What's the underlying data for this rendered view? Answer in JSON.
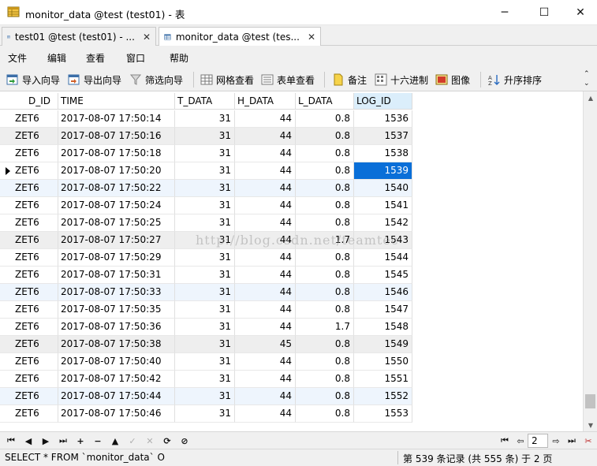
{
  "window": {
    "title": "monitor_data @test (test01) - 表",
    "controls": {
      "minimize": "─",
      "maximize": "☐",
      "close": "✕"
    }
  },
  "tabs": [
    {
      "label": "test01 @test (test01) - ...",
      "close": "✕",
      "active": false
    },
    {
      "label": "monitor_data @test (tes...",
      "close": "✕",
      "active": true
    }
  ],
  "menu": [
    "文件",
    "编辑",
    "查看",
    "窗口",
    "帮助"
  ],
  "toolbar": {
    "import_wizard": "导入向导",
    "export_wizard": "导出向导",
    "filter_wizard": "筛选向导",
    "grid_view": "网格查看",
    "form_view": "表单查看",
    "memo": "备注",
    "hex": "十六进制",
    "image": "图像",
    "sort_asc": "升序排序",
    "overflow": "⌃⌄"
  },
  "grid": {
    "columns": [
      "D_ID",
      "TIME",
      "T_DATA",
      "H_DATA",
      "L_DATA",
      "LOG_ID"
    ],
    "sorted_column_index": 0,
    "selected_column_index": 5,
    "rows": [
      [
        "ZET6",
        "2017-08-07 17:50:14",
        "31",
        "44",
        "0.8",
        "1536"
      ],
      [
        "ZET6",
        "2017-08-07 17:50:16",
        "31",
        "44",
        "0.8",
        "1537"
      ],
      [
        "ZET6",
        "2017-08-07 17:50:18",
        "31",
        "44",
        "0.8",
        "1538"
      ],
      [
        "ZET6",
        "2017-08-07 17:50:20",
        "31",
        "44",
        "0.8",
        "1539"
      ],
      [
        "ZET6",
        "2017-08-07 17:50:22",
        "31",
        "44",
        "0.8",
        "1540"
      ],
      [
        "ZET6",
        "2017-08-07 17:50:24",
        "31",
        "44",
        "0.8",
        "1541"
      ],
      [
        "ZET6",
        "2017-08-07 17:50:25",
        "31",
        "44",
        "0.8",
        "1542"
      ],
      [
        "ZET6",
        "2017-08-07 17:50:27",
        "31",
        "44",
        "1.7",
        "1543"
      ],
      [
        "ZET6",
        "2017-08-07 17:50:29",
        "31",
        "44",
        "0.8",
        "1544"
      ],
      [
        "ZET6",
        "2017-08-07 17:50:31",
        "31",
        "44",
        "0.8",
        "1545"
      ],
      [
        "ZET6",
        "2017-08-07 17:50:33",
        "31",
        "44",
        "0.8",
        "1546"
      ],
      [
        "ZET6",
        "2017-08-07 17:50:35",
        "31",
        "44",
        "0.8",
        "1547"
      ],
      [
        "ZET6",
        "2017-08-07 17:50:36",
        "31",
        "44",
        "1.7",
        "1548"
      ],
      [
        "ZET6",
        "2017-08-07 17:50:38",
        "31",
        "45",
        "0.8",
        "1549"
      ],
      [
        "ZET6",
        "2017-08-07 17:50:40",
        "31",
        "44",
        "0.8",
        "1550"
      ],
      [
        "ZET6",
        "2017-08-07 17:50:42",
        "31",
        "44",
        "0.8",
        "1551"
      ],
      [
        "ZET6",
        "2017-08-07 17:50:44",
        "31",
        "44",
        "0.8",
        "1552"
      ],
      [
        "ZET6",
        "2017-08-07 17:50:46",
        "31",
        "44",
        "0.8",
        "1553"
      ]
    ],
    "current_row_index": 3,
    "selected_cell": {
      "row": 3,
      "col": 5
    },
    "row_shading": [
      "white",
      "gray",
      "white",
      "white",
      "blue",
      "white",
      "white",
      "gray",
      "white",
      "white",
      "blue",
      "white",
      "white",
      "gray",
      "white",
      "white",
      "blue",
      "white"
    ]
  },
  "watermark": "http://blog.csdn.net/teamtec",
  "navigation": {
    "first": "⏮",
    "prev": "◀",
    "next": "▶",
    "last": "⏭",
    "add": "+",
    "delete": "−",
    "up": "▲",
    "check": "✓",
    "cancel": "✕",
    "refresh": "⟳",
    "stop": "⊘",
    "page_first": "⏮",
    "page_prev": "⇦",
    "page_value": "2",
    "page_next": "⇨",
    "page_last": "⏭",
    "settings": "✂"
  },
  "status": {
    "sql": "SELECT * FROM `monitor_data` O",
    "record_info": "第 539 条记录 (共 555 条) 于 2 页"
  },
  "colors": {
    "selection": "#0a6fd8",
    "header_selected": "#dbeefb",
    "row_gray": "#eeeeee",
    "row_blue": "#eef5fd",
    "chrome": "#f0f0f0"
  }
}
